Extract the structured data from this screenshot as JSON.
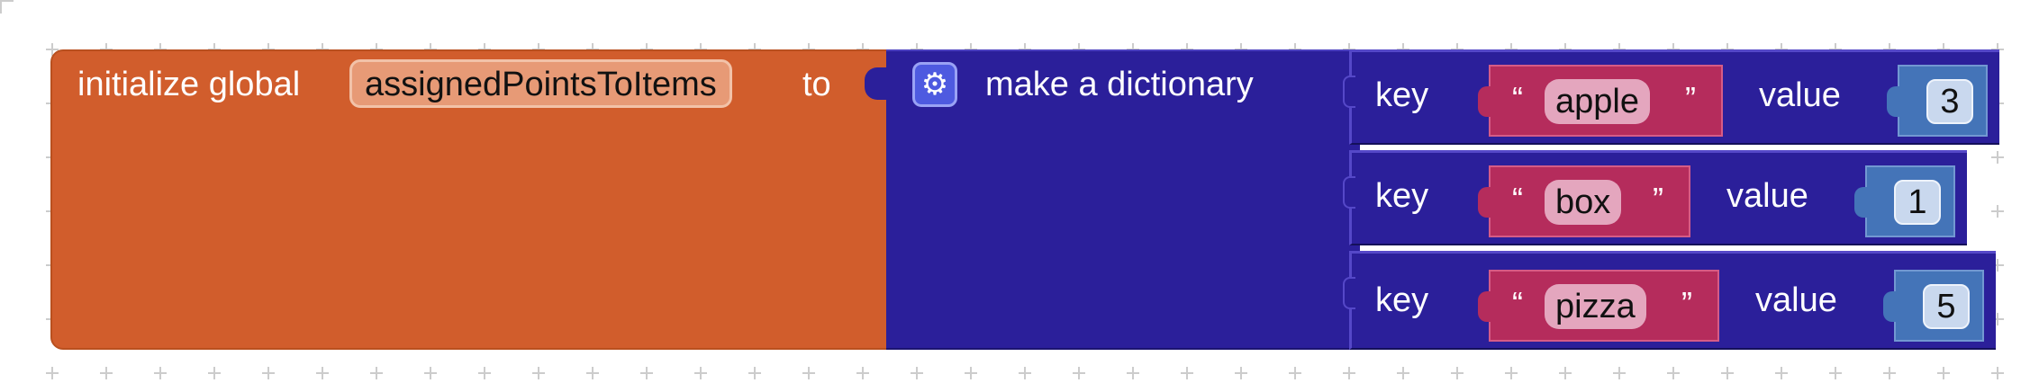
{
  "init_block": {
    "keyword": "initialize global",
    "variable_name": "assignedPointsToItems",
    "to_label": "to",
    "color": "#d15d2c"
  },
  "dict_block": {
    "label": "make a dictionary",
    "mutator_icon": "gear-icon",
    "color": "#2b1f9a"
  },
  "pairs": [
    {
      "key_label": "key",
      "open_quote": "“",
      "key": "apple",
      "close_quote": "”",
      "value_label": "value",
      "value": "3"
    },
    {
      "key_label": "key",
      "open_quote": "“",
      "key": "box",
      "close_quote": "”",
      "value_label": "value",
      "value": "1"
    },
    {
      "key_label": "key",
      "open_quote": "“",
      "key": "pizza",
      "close_quote": "”",
      "value_label": "value",
      "value": "5"
    }
  ],
  "colors": {
    "text_block": "#b52c5c",
    "math_block": "#4474b8",
    "workspace_grid": "#cccccc"
  }
}
